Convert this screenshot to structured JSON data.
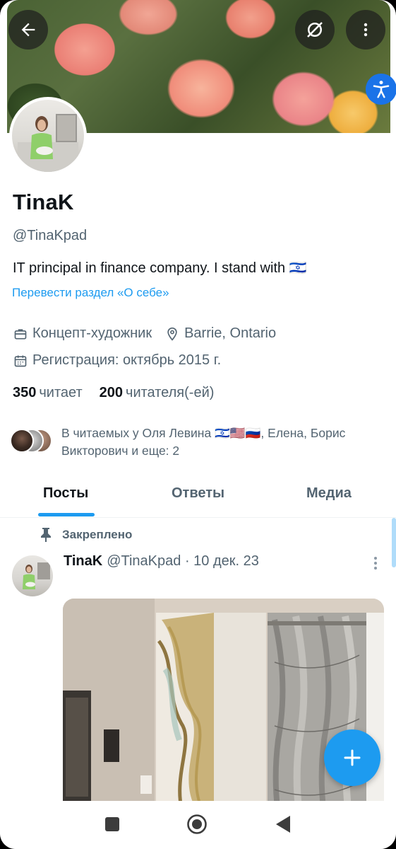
{
  "profile": {
    "name": "TinaK",
    "handle": "@TinaKpad",
    "bio": "IT principal in finance company. I stand with 🇮🇱",
    "translate_link": "Перевести раздел «О себе»",
    "profession": "Концепт-художник",
    "location": "Barrie, Ontario",
    "joined": "Регистрация: октябрь 2015 г."
  },
  "stats": {
    "following_count": "350",
    "following_label": "читает",
    "followers_count": "200",
    "followers_label": "читателя(-ей)"
  },
  "followed_by": {
    "text": "В читаемых у Оля Левина 🇮🇱🇺🇸🇷🇺, Елена, Борис Викторович и еще: 2"
  },
  "tabs": [
    {
      "label": "Посты",
      "active": true
    },
    {
      "label": "Ответы",
      "active": false
    },
    {
      "label": "Медиа",
      "active": false
    }
  ],
  "pinned_post": {
    "pinned_label": "Закреплено",
    "author_name": "TinaK",
    "author_handle": "@TinaKpad",
    "date": "· 10 дек. 23"
  },
  "icons": {
    "back": "arrow-left-icon",
    "no_search": "no-search-icon",
    "more": "more-vertical-icon",
    "accessibility": "accessibility-icon",
    "briefcase": "briefcase-icon",
    "location": "location-pin-icon",
    "calendar": "calendar-icon",
    "pin": "pin-icon",
    "compose": "plus-icon"
  },
  "colors": {
    "accent": "#1d9bf0",
    "secondary_text": "#536471",
    "primary_text": "#0f1419"
  }
}
